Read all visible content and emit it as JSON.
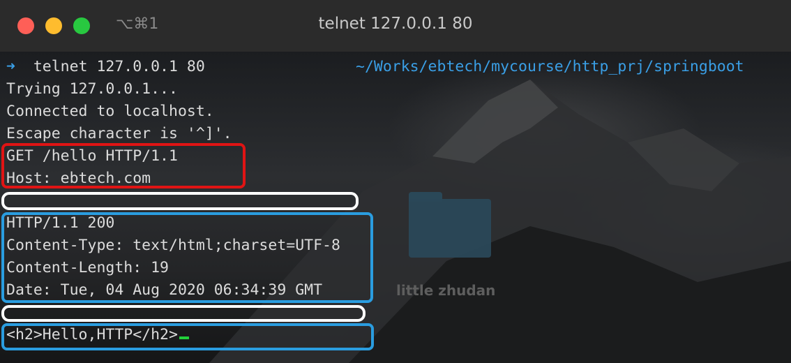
{
  "window": {
    "title": "telnet 127.0.0.1 80",
    "shortcut": "⌥⌘1"
  },
  "terminal": {
    "prompt_symbol": "➜",
    "command": "telnet 127.0.0.1 80",
    "cwd": "~/Works/ebtech/mycourse/http_prj/springboot",
    "lines": [
      "Trying 127.0.0.1...",
      "Connected to localhost.",
      "Escape character is '^]'.",
      "GET /hello HTTP/1.1",
      "Host: ebtech.com",
      "HTTP/1.1 200",
      "Content-Type: text/html;charset=UTF-8",
      "Content-Length: 19",
      "Date: Tue, 04 Aug 2020 06:34:39 GMT",
      "<h2>Hello,HTTP</h2>"
    ]
  },
  "desktop": {
    "folder_label": "little zhudan"
  },
  "colors": {
    "prompt_blue": "#3a9fe6",
    "request_box": "#e01414",
    "response_box": "#2a9de0",
    "cursor": "#22d13a"
  }
}
